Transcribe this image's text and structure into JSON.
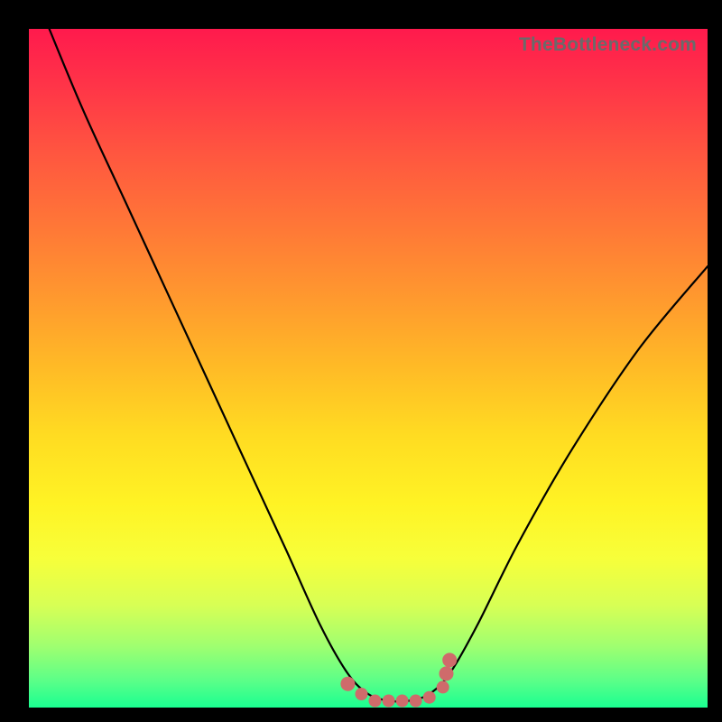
{
  "watermark": "TheBottleneck.com",
  "colors": {
    "frame": "#000000",
    "gradient_top": "#ff1a4d",
    "gradient_bottom": "#1aff91",
    "curve": "#000000",
    "markers": "#cf6b6b"
  },
  "chart_data": {
    "type": "line",
    "title": "",
    "xlabel": "",
    "ylabel": "",
    "xlim": [
      0,
      100
    ],
    "ylim": [
      0,
      100
    ],
    "series": [
      {
        "name": "bottleneck-curve",
        "x": [
          3,
          8,
          14,
          20,
          26,
          32,
          38,
          43,
          47,
          50,
          53,
          56,
          59,
          62,
          66,
          72,
          80,
          90,
          100
        ],
        "y": [
          100,
          88,
          75,
          62,
          49,
          36,
          23,
          12,
          5,
          2,
          1,
          1,
          2,
          5,
          12,
          24,
          38,
          53,
          65
        ]
      }
    ],
    "markers": {
      "name": "highlight-points",
      "x": [
        47,
        49,
        51,
        53,
        55,
        57,
        59,
        61,
        61.5,
        62
      ],
      "y": [
        3.5,
        2,
        1,
        1,
        1,
        1,
        1.5,
        3,
        5,
        7
      ]
    }
  }
}
